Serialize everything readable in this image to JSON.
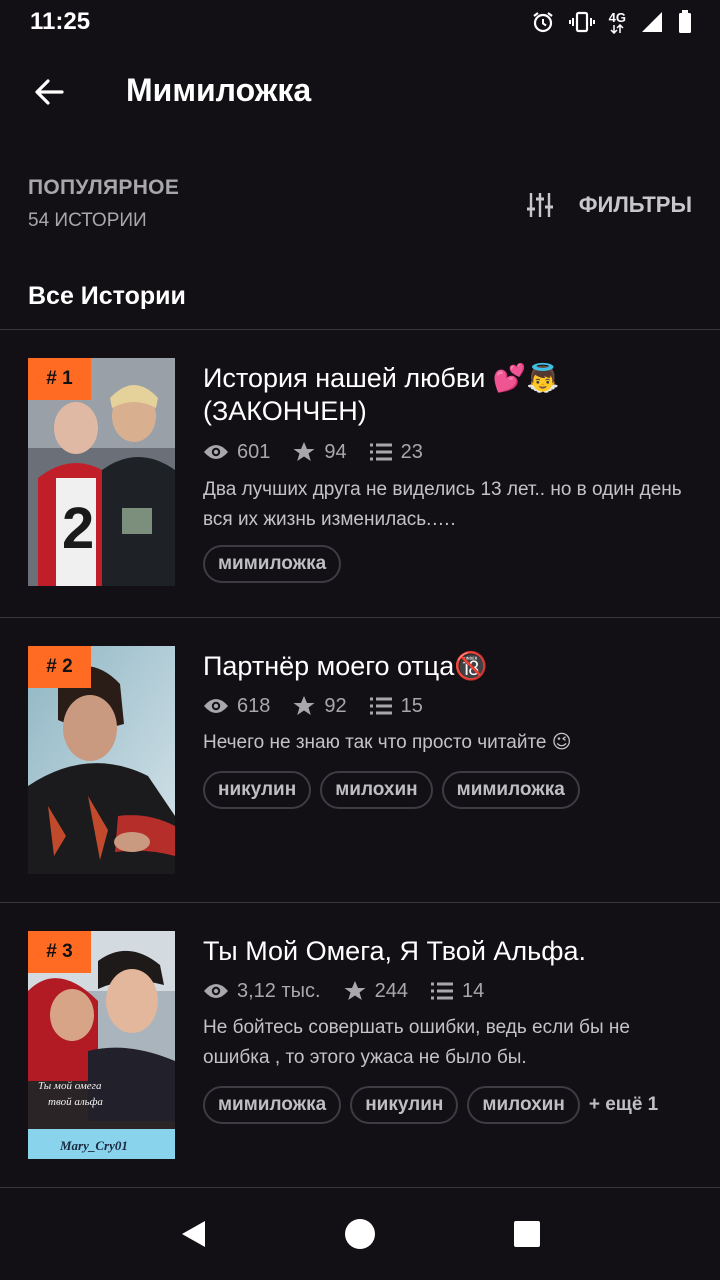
{
  "status_bar": {
    "time": "11:25",
    "network": "4G",
    "icons": [
      "alarm-icon",
      "vibrate-icon",
      "signal-icon",
      "battery-icon"
    ]
  },
  "app_bar": {
    "title": "Мимиложка",
    "back_icon": "arrow-left-icon"
  },
  "section": {
    "title": "ПОПУЛЯРНОЕ",
    "count": "54 ИСТОРИИ",
    "filters_label": "ФИЛЬТРЫ",
    "filters_icon": "sliders-icon"
  },
  "list_heading": "Все Истории",
  "colors": {
    "background": "#121015",
    "rank_badge": "#ff6b22",
    "divider": "#38363c",
    "muted_text": "#a8a8ab"
  },
  "stories": [
    {
      "rank": "# 1",
      "title": "История нашей любви 💕👼 (ЗАКОНЧЕН)",
      "views": "601",
      "votes": "94",
      "parts": "23",
      "description": "Два лучших друга не виделись 13 лет.. но в один день вся их жизнь изменилась.….",
      "tags": [
        "мимиложка"
      ],
      "more_tags": ""
    },
    {
      "rank": "# 2",
      "title": "Партнёр моего отца🔞",
      "views": "618",
      "votes": "92",
      "parts": "15",
      "description": "Нечего не знаю так что просто читайте 😉",
      "tags": [
        "никулин",
        "милохин",
        "мимиложка"
      ],
      "more_tags": ""
    },
    {
      "rank": "# 3",
      "title": "Ты Мой Омега, Я Твой Альфа.",
      "views": "3,12 тыс.",
      "votes": "244",
      "parts": "14",
      "description": "Не бойтесь совершать ошибки, ведь если бы не ошибка , то этого ужаса не было бы.",
      "tags": [
        "мимиложка",
        "никулин",
        "милохин"
      ],
      "more_tags": "+ ещё 1"
    }
  ]
}
